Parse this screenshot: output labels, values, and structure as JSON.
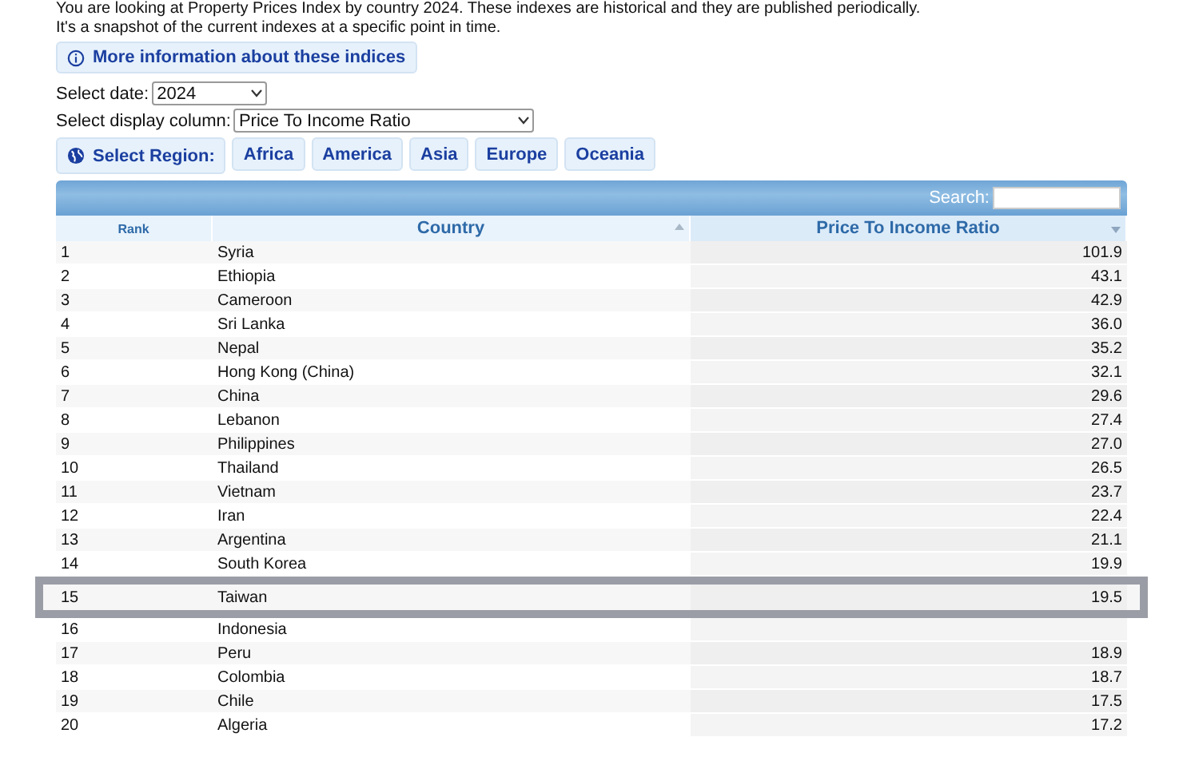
{
  "intro": {
    "lines": [
      "You are looking at Property Prices Index by country 2024. These indexes are historical and they are published periodically.",
      "It's a snapshot of the current indexes at a specific point in time."
    ]
  },
  "info_button": "More information about these indices",
  "date_select": {
    "label": "Select date:",
    "value": "2024"
  },
  "column_select": {
    "label": "Select display column:",
    "value": "Price To Income Ratio"
  },
  "region": {
    "label": "Select Region:",
    "options": [
      "Africa",
      "America",
      "Asia",
      "Europe",
      "Oceania"
    ]
  },
  "search": {
    "label": "Search:"
  },
  "table": {
    "columns": [
      {
        "label": "Rank",
        "sortable": false,
        "selected": false
      },
      {
        "label": "Country",
        "sortable": true,
        "descending": false,
        "selected": false
      },
      {
        "label": "Price To Income Ratio",
        "sortable": true,
        "descending": true,
        "selected": true
      }
    ],
    "rows": [
      {
        "rank": "1",
        "country": "Syria",
        "value": "101.9",
        "highlighted": false
      },
      {
        "rank": "2",
        "country": "Ethiopia",
        "value": "43.1",
        "highlighted": false
      },
      {
        "rank": "3",
        "country": "Cameroon",
        "value": "42.9",
        "highlighted": false
      },
      {
        "rank": "4",
        "country": "Sri Lanka",
        "value": "36.0",
        "highlighted": false
      },
      {
        "rank": "5",
        "country": "Nepal",
        "value": "35.2",
        "highlighted": false
      },
      {
        "rank": "6",
        "country": "Hong Kong (China)",
        "value": "32.1",
        "highlighted": false
      },
      {
        "rank": "7",
        "country": "China",
        "value": "29.6",
        "highlighted": false
      },
      {
        "rank": "8",
        "country": "Lebanon",
        "value": "27.4",
        "highlighted": false
      },
      {
        "rank": "9",
        "country": "Philippines",
        "value": "27.0",
        "highlighted": false
      },
      {
        "rank": "10",
        "country": "Thailand",
        "value": "26.5",
        "highlighted": false
      },
      {
        "rank": "11",
        "country": "Vietnam",
        "value": "23.7",
        "highlighted": false
      },
      {
        "rank": "12",
        "country": "Iran",
        "value": "22.4",
        "highlighted": false
      },
      {
        "rank": "13",
        "country": "Argentina",
        "value": "21.1",
        "highlighted": false
      },
      {
        "rank": "14",
        "country": "South Korea",
        "value": "19.9",
        "highlighted": false
      },
      {
        "rank": "15",
        "country": "Taiwan",
        "value": "19.5",
        "highlighted": true
      },
      {
        "rank": "16",
        "country": "Indonesia",
        "highlighted": false
      },
      {
        "rank": "17",
        "country": "Peru",
        "value": "18.9",
        "highlighted": false
      },
      {
        "rank": "18",
        "country": "Colombia",
        "value": "18.7",
        "highlighted": false
      },
      {
        "rank": "19",
        "country": "Chile",
        "value": "17.5",
        "highlighted": false
      },
      {
        "rank": "20",
        "country": "Algeria",
        "value": "17.2",
        "highlighted": false
      }
    ]
  }
}
